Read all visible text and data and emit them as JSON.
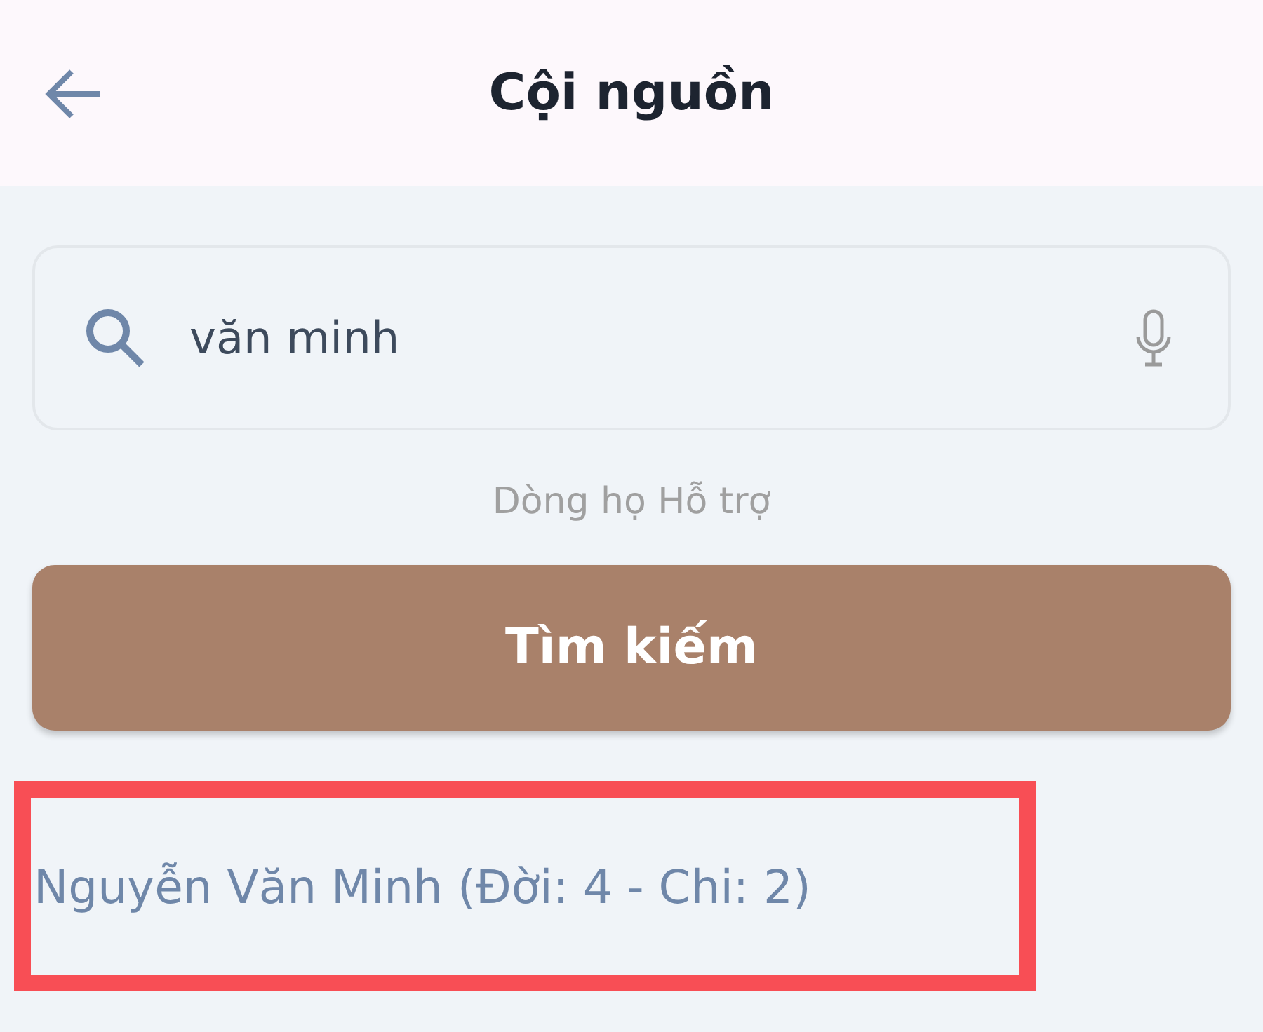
{
  "header": {
    "title": "Cội nguồn"
  },
  "search": {
    "value": "văn minh"
  },
  "hint": "Dòng họ Hỗ trợ",
  "search_button": "Tìm kiếm",
  "results": [
    {
      "label": "Nguyễn Văn Minh (Đời: 4 - Chi: 2)",
      "highlighted": true
    }
  ]
}
